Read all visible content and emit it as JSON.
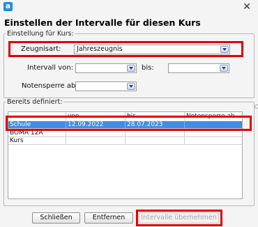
{
  "window": {
    "app_icon_letter": "a",
    "close_glyph": "✕"
  },
  "dialog": {
    "title": "Einstellen der Intervalle für diesen Kurs"
  },
  "settings_group": {
    "legend": "Einstellung für Kurs:",
    "zeugnisart_label": "Zeugnisart:",
    "zeugnisart_value": "Jahreszeugnis",
    "intervall_von_label": "Intervall von:",
    "intervall_von_value": "",
    "bis_label": "bis:",
    "bis_value": "",
    "notensperre_label": "Notensperre ab:",
    "notensperre_value": ""
  },
  "defined_group": {
    "legend": "Bereits definiert:",
    "columns": [
      "",
      "von",
      "bis",
      "Notensperre ab"
    ],
    "rows": [
      {
        "name": "Schule",
        "von": "12.09.2022",
        "bis": "28.07.2023",
        "notensperre": "",
        "selected": true
      },
      {
        "name": "BOMA 12A",
        "von": "",
        "bis": "",
        "notensperre": "",
        "selected": false
      },
      {
        "name": "Kurs",
        "von": "",
        "bis": "",
        "notensperre": "",
        "selected": false
      }
    ]
  },
  "buttons": {
    "close": "Schließen",
    "remove": "Entfernen",
    "apply": "Intervalle übernehmen"
  },
  "colors": {
    "highlight_box": "#e00000",
    "selection": "#3d8ee6",
    "app_icon": "#1d8ee0"
  }
}
